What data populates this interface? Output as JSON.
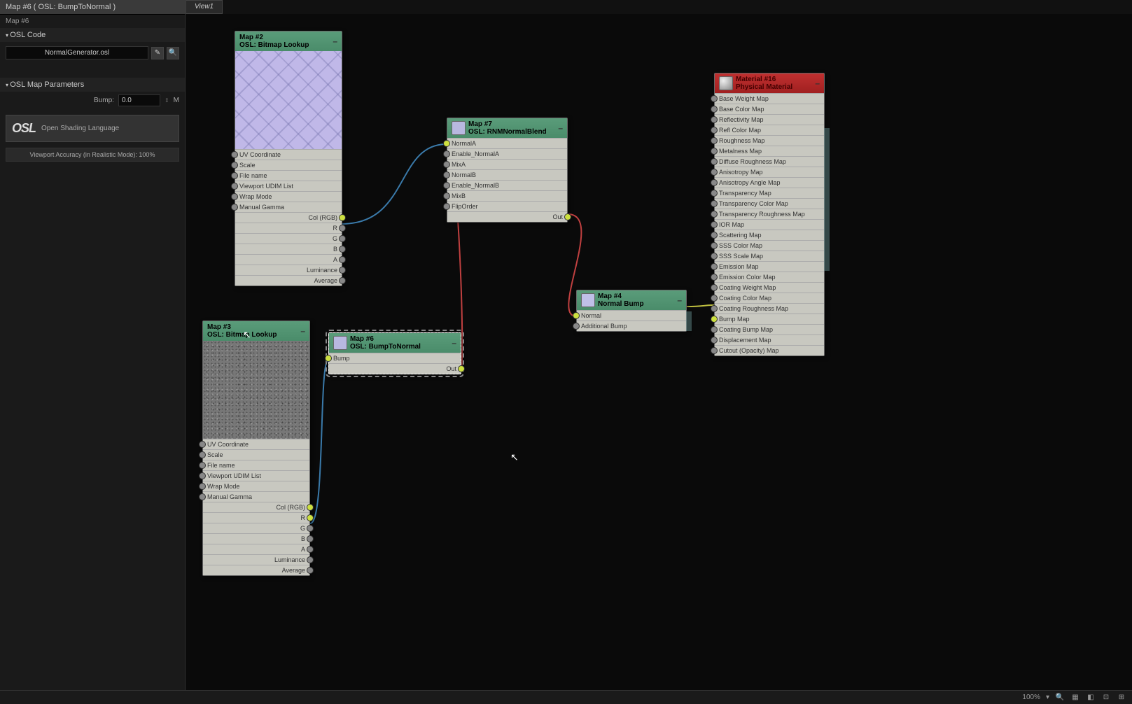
{
  "titlebar": "Map #6 ( OSL: BumpToNormal )",
  "subtitle": "Map #6",
  "sections": {
    "osl_code": "OSL Code",
    "osl_params": "OSL Map Parameters"
  },
  "filename": "NormalGenerator.osl",
  "param": {
    "bump_label": "Bump:",
    "bump_value": "0.0",
    "m": "M"
  },
  "osl_logo": {
    "mark": "OSL",
    "text": "Open Shading Language"
  },
  "accuracy": "Viewport Accuracy (in Realistic Mode): 100%",
  "tab": "View1",
  "status": {
    "zoom": "100%",
    "sep": "▾"
  },
  "nodes": {
    "map2": {
      "title": "Map #2",
      "sub": "OSL: Bitmap Lookup",
      "ins": [
        "UV Coordinate",
        "Scale",
        "File name",
        "Viewport UDIM List",
        "Wrap Mode",
        "Manual Gamma"
      ],
      "outs": [
        "Col (RGB)",
        "R",
        "G",
        "B",
        "A",
        "Luminance",
        "Average"
      ]
    },
    "map3": {
      "title": "Map #3",
      "sub": "OSL: Bitmap Lookup",
      "ins": [
        "UV Coordinate",
        "Scale",
        "File name",
        "Viewport UDIM List",
        "Wrap Mode",
        "Manual Gamma"
      ],
      "outs": [
        "Col (RGB)",
        "R",
        "G",
        "B",
        "A",
        "Luminance",
        "Average"
      ]
    },
    "map6": {
      "title": "Map #6",
      "sub": "OSL: BumpToNormal",
      "ins": [
        "Bump"
      ],
      "outs": [
        "Out"
      ]
    },
    "map7": {
      "title": "Map #7",
      "sub": "OSL: RNMNormalBlend",
      "ins": [
        "NormalA",
        "Enable_NormalA",
        "MixA",
        "NormalB",
        "Enable_NormalB",
        "MixB",
        "FlipOrder"
      ],
      "outs": [
        "Out"
      ]
    },
    "map4": {
      "title": "Map #4",
      "sub": "Normal Bump",
      "ins": [
        "Normal",
        "Additional Bump"
      ]
    },
    "material": {
      "title": "Material #16",
      "sub": "Physical Material",
      "ins": [
        "Base Weight Map",
        "Base Color Map",
        "Reflectivity Map",
        "Refl Color Map",
        "Roughness Map",
        "Metalness Map",
        "Diffuse Roughness Map",
        "Anisotropy Map",
        "Anisotropy Angle Map",
        "Transparency Map",
        "Transparency Color Map",
        "Transparency Roughness Map",
        "IOR Map",
        "Scattering Map",
        "SSS Color Map",
        "SSS Scale Map",
        "Emission Map",
        "Emission Color Map",
        "Coating Weight Map",
        "Coating Color Map",
        "Coating Roughness Map",
        "Bump Map",
        "Coating Bump Map",
        "Displacement Map",
        "Cutout (Opacity) Map"
      ]
    }
  }
}
